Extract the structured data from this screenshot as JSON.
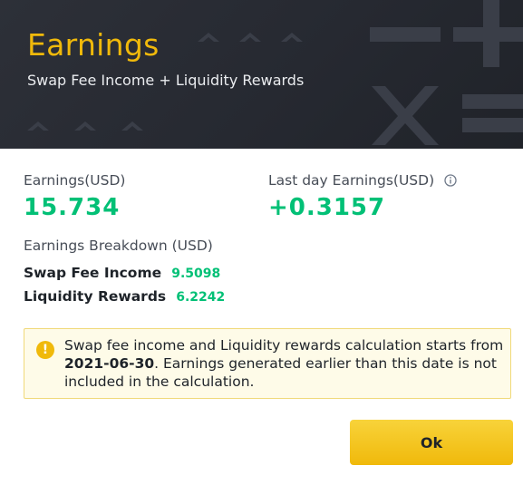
{
  "header": {
    "title": "Earnings",
    "subtitle": "Swap Fee Income + Liquidity Rewards"
  },
  "earnings": {
    "label": "Earnings(USD)",
    "value": "15.734"
  },
  "last_day": {
    "label": "Last day Earnings(USD)",
    "value": "+0.3157",
    "icon": "info-icon"
  },
  "breakdown": {
    "title": "Earnings Breakdown (USD)",
    "items": [
      {
        "label": "Swap Fee Income",
        "value": "9.5098"
      },
      {
        "label": "Liquidity Rewards",
        "value": "6.2242"
      }
    ]
  },
  "notice": {
    "icon": "warning-icon",
    "text_before": "Swap fee income and Liquidity rewards calculation starts from ",
    "date": "2021-06-30",
    "text_after": ". Earnings generated earlier than this date is not included in the calculation."
  },
  "actions": {
    "ok_label": "Ok"
  },
  "colors": {
    "accent": "#f0b90b",
    "positive": "#02c076",
    "header_bg": "#2a2d35"
  }
}
